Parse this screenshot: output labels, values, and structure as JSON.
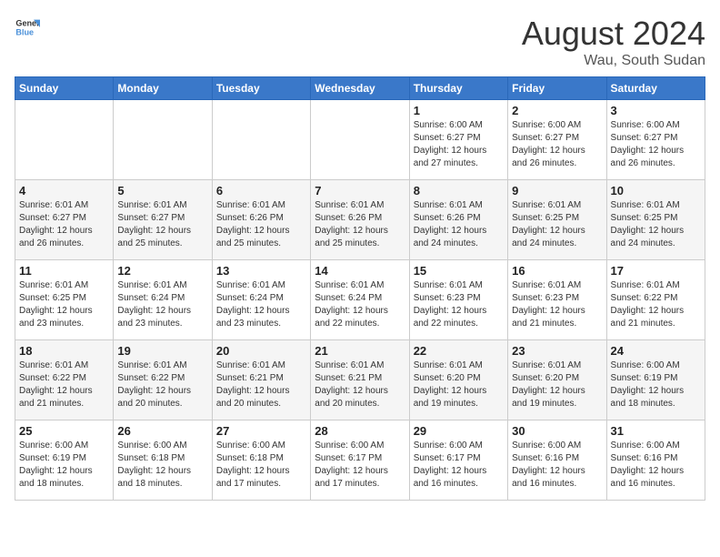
{
  "header": {
    "logo_line1": "General",
    "logo_line2": "Blue",
    "title": "August 2024",
    "subtitle": "Wau, South Sudan"
  },
  "weekdays": [
    "Sunday",
    "Monday",
    "Tuesday",
    "Wednesday",
    "Thursday",
    "Friday",
    "Saturday"
  ],
  "weeks": [
    [
      {
        "day": "",
        "content": ""
      },
      {
        "day": "",
        "content": ""
      },
      {
        "day": "",
        "content": ""
      },
      {
        "day": "",
        "content": ""
      },
      {
        "day": "1",
        "content": "Sunrise: 6:00 AM\nSunset: 6:27 PM\nDaylight: 12 hours\nand 27 minutes."
      },
      {
        "day": "2",
        "content": "Sunrise: 6:00 AM\nSunset: 6:27 PM\nDaylight: 12 hours\nand 26 minutes."
      },
      {
        "day": "3",
        "content": "Sunrise: 6:00 AM\nSunset: 6:27 PM\nDaylight: 12 hours\nand 26 minutes."
      }
    ],
    [
      {
        "day": "4",
        "content": "Sunrise: 6:01 AM\nSunset: 6:27 PM\nDaylight: 12 hours\nand 26 minutes."
      },
      {
        "day": "5",
        "content": "Sunrise: 6:01 AM\nSunset: 6:27 PM\nDaylight: 12 hours\nand 25 minutes."
      },
      {
        "day": "6",
        "content": "Sunrise: 6:01 AM\nSunset: 6:26 PM\nDaylight: 12 hours\nand 25 minutes."
      },
      {
        "day": "7",
        "content": "Sunrise: 6:01 AM\nSunset: 6:26 PM\nDaylight: 12 hours\nand 25 minutes."
      },
      {
        "day": "8",
        "content": "Sunrise: 6:01 AM\nSunset: 6:26 PM\nDaylight: 12 hours\nand 24 minutes."
      },
      {
        "day": "9",
        "content": "Sunrise: 6:01 AM\nSunset: 6:25 PM\nDaylight: 12 hours\nand 24 minutes."
      },
      {
        "day": "10",
        "content": "Sunrise: 6:01 AM\nSunset: 6:25 PM\nDaylight: 12 hours\nand 24 minutes."
      }
    ],
    [
      {
        "day": "11",
        "content": "Sunrise: 6:01 AM\nSunset: 6:25 PM\nDaylight: 12 hours\nand 23 minutes."
      },
      {
        "day": "12",
        "content": "Sunrise: 6:01 AM\nSunset: 6:24 PM\nDaylight: 12 hours\nand 23 minutes."
      },
      {
        "day": "13",
        "content": "Sunrise: 6:01 AM\nSunset: 6:24 PM\nDaylight: 12 hours\nand 23 minutes."
      },
      {
        "day": "14",
        "content": "Sunrise: 6:01 AM\nSunset: 6:24 PM\nDaylight: 12 hours\nand 22 minutes."
      },
      {
        "day": "15",
        "content": "Sunrise: 6:01 AM\nSunset: 6:23 PM\nDaylight: 12 hours\nand 22 minutes."
      },
      {
        "day": "16",
        "content": "Sunrise: 6:01 AM\nSunset: 6:23 PM\nDaylight: 12 hours\nand 21 minutes."
      },
      {
        "day": "17",
        "content": "Sunrise: 6:01 AM\nSunset: 6:22 PM\nDaylight: 12 hours\nand 21 minutes."
      }
    ],
    [
      {
        "day": "18",
        "content": "Sunrise: 6:01 AM\nSunset: 6:22 PM\nDaylight: 12 hours\nand 21 minutes."
      },
      {
        "day": "19",
        "content": "Sunrise: 6:01 AM\nSunset: 6:22 PM\nDaylight: 12 hours\nand 20 minutes."
      },
      {
        "day": "20",
        "content": "Sunrise: 6:01 AM\nSunset: 6:21 PM\nDaylight: 12 hours\nand 20 minutes."
      },
      {
        "day": "21",
        "content": "Sunrise: 6:01 AM\nSunset: 6:21 PM\nDaylight: 12 hours\nand 20 minutes."
      },
      {
        "day": "22",
        "content": "Sunrise: 6:01 AM\nSunset: 6:20 PM\nDaylight: 12 hours\nand 19 minutes."
      },
      {
        "day": "23",
        "content": "Sunrise: 6:01 AM\nSunset: 6:20 PM\nDaylight: 12 hours\nand 19 minutes."
      },
      {
        "day": "24",
        "content": "Sunrise: 6:00 AM\nSunset: 6:19 PM\nDaylight: 12 hours\nand 18 minutes."
      }
    ],
    [
      {
        "day": "25",
        "content": "Sunrise: 6:00 AM\nSunset: 6:19 PM\nDaylight: 12 hours\nand 18 minutes."
      },
      {
        "day": "26",
        "content": "Sunrise: 6:00 AM\nSunset: 6:18 PM\nDaylight: 12 hours\nand 18 minutes."
      },
      {
        "day": "27",
        "content": "Sunrise: 6:00 AM\nSunset: 6:18 PM\nDaylight: 12 hours\nand 17 minutes."
      },
      {
        "day": "28",
        "content": "Sunrise: 6:00 AM\nSunset: 6:17 PM\nDaylight: 12 hours\nand 17 minutes."
      },
      {
        "day": "29",
        "content": "Sunrise: 6:00 AM\nSunset: 6:17 PM\nDaylight: 12 hours\nand 16 minutes."
      },
      {
        "day": "30",
        "content": "Sunrise: 6:00 AM\nSunset: 6:16 PM\nDaylight: 12 hours\nand 16 minutes."
      },
      {
        "day": "31",
        "content": "Sunrise: 6:00 AM\nSunset: 6:16 PM\nDaylight: 12 hours\nand 16 minutes."
      }
    ]
  ]
}
